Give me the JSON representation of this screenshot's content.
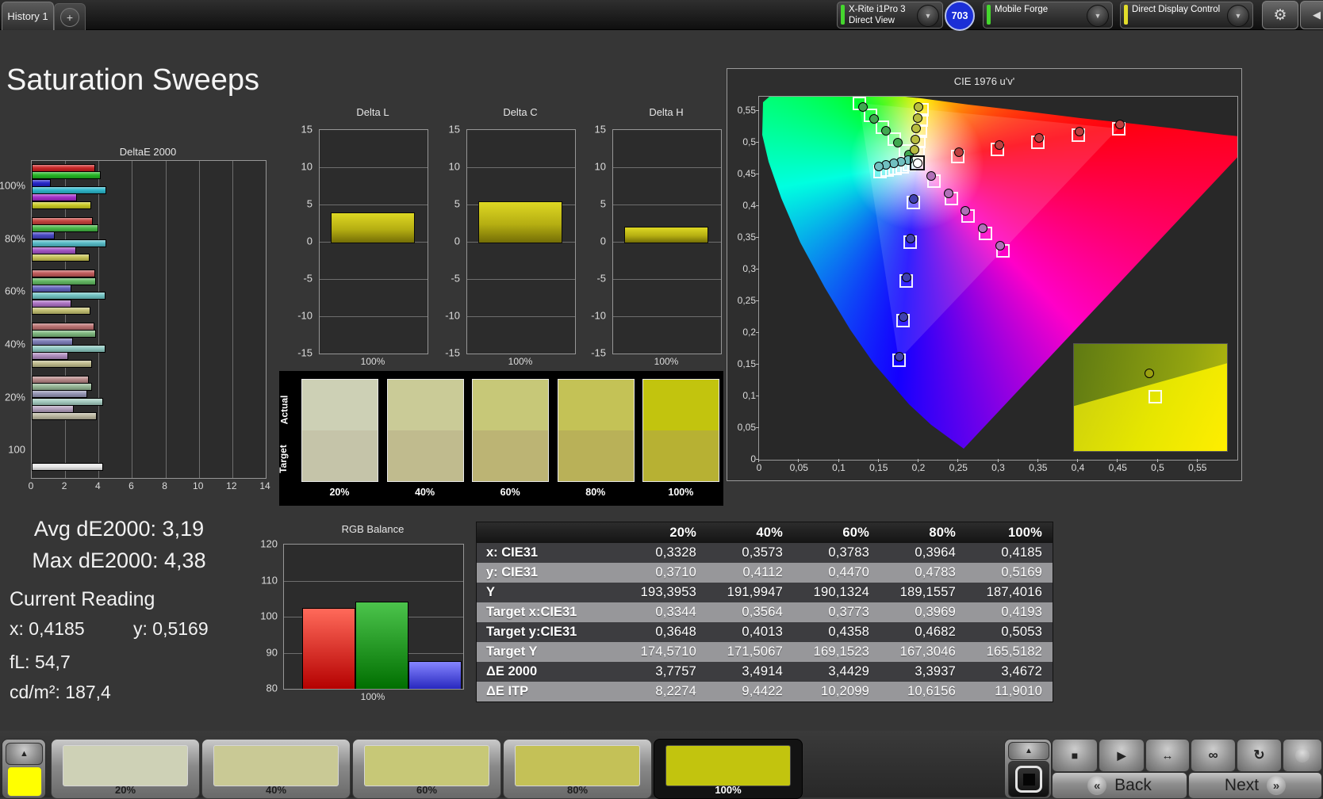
{
  "top_bar": {
    "tab_label": "History 1",
    "add_tab_label": "+",
    "meter_device": {
      "line1": "X-Rite i1Pro 3",
      "line2": "Direct View",
      "status_color": "#45d62e"
    },
    "badge_count": "703",
    "pattern_source": {
      "label": "Mobile Forge",
      "status_color": "#45d62e"
    },
    "display_control": {
      "label": "Direct Display Control",
      "status_color": "#e3de2b"
    }
  },
  "icons": {
    "dropdown": "▼",
    "up_arrow": "▲",
    "collapse_left": "◀",
    "gear": "⚙",
    "add": "+",
    "stop": "■",
    "play": "▶",
    "range": "↔",
    "loop": "∞",
    "refresh": "↻",
    "back_chevron": "«",
    "next_chevron": "»"
  },
  "page_title": "Saturation Sweeps",
  "stats": {
    "avg_label": "Avg dE2000:",
    "avg_value": "3,19",
    "max_label": "Max dE2000:",
    "max_value": "4,38",
    "current_reading_title": "Current Reading",
    "x_label": "x:",
    "x_value": "0,4185",
    "y_label": "y:",
    "y_value": "0,5169",
    "fl_label": "fL:",
    "fl_value": "54,7",
    "cdm2_label": "cd/m²:",
    "cdm2_value": "187,4"
  },
  "swatch_panel": {
    "actual_label": "Actual",
    "target_label": "Target",
    "columns": [
      {
        "label": "20%",
        "actual": "#cdd0b5",
        "target": "#c5c4a9"
      },
      {
        "label": "40%",
        "actual": "#cacb97",
        "target": "#c0bb8e"
      },
      {
        "label": "60%",
        "actual": "#c7c878",
        "target": "#bcb474"
      },
      {
        "label": "80%",
        "actual": "#c4c256",
        "target": "#b9b158"
      },
      {
        "label": "100%",
        "actual": "#c2c40e",
        "target": "#b7b133"
      }
    ]
  },
  "table": {
    "columns": [
      "20%",
      "40%",
      "60%",
      "80%",
      "100%"
    ],
    "rows": [
      {
        "label": "x: CIE31",
        "values": [
          "0,3328",
          "0,3573",
          "0,3783",
          "0,3964",
          "0,4185"
        ]
      },
      {
        "label": "y: CIE31",
        "values": [
          "0,3710",
          "0,4112",
          "0,4470",
          "0,4783",
          "0,5169"
        ]
      },
      {
        "label": "Y",
        "values": [
          "193,3953",
          "191,9947",
          "190,1324",
          "189,1557",
          "187,4016"
        ]
      },
      {
        "label": "Target x:CIE31",
        "values": [
          "0,3344",
          "0,3564",
          "0,3773",
          "0,3969",
          "0,4193"
        ]
      },
      {
        "label": "Target y:CIE31",
        "values": [
          "0,3648",
          "0,4013",
          "0,4358",
          "0,4682",
          "0,5053"
        ]
      },
      {
        "label": "Target Y",
        "values": [
          "174,5710",
          "171,5067",
          "169,1523",
          "167,3046",
          "165,5182"
        ]
      },
      {
        "label": "ΔE 2000",
        "values": [
          "3,7757",
          "3,4914",
          "3,4429",
          "3,3937",
          "3,4672"
        ]
      },
      {
        "label": "ΔE ITP",
        "values": [
          "8,2274",
          "9,4422",
          "10,2099",
          "10,6156",
          "11,9010"
        ]
      }
    ]
  },
  "bottom_bar": {
    "current_patch_color": "#ffff00",
    "patch_buttons": [
      {
        "label": "20%",
        "color": "#ced1b6",
        "selected": false
      },
      {
        "label": "40%",
        "color": "#c9c995",
        "selected": false
      },
      {
        "label": "60%",
        "color": "#c7c877",
        "selected": false
      },
      {
        "label": "80%",
        "color": "#c4c157",
        "selected": false
      },
      {
        "label": "100%",
        "color": "#c2c40e",
        "selected": true
      }
    ],
    "back_label": "Back",
    "next_label": "Next"
  },
  "chart_data": [
    {
      "type": "bar",
      "orientation": "horizontal",
      "title": "DeltaE 2000",
      "xlim": [
        0,
        14
      ],
      "xticks": [
        0,
        2,
        4,
        6,
        8,
        10,
        12,
        14
      ],
      "xtick_labels": [
        "0",
        "2",
        "4",
        "6",
        "8",
        "10",
        "12",
        "14"
      ],
      "groups": [
        {
          "label": "100%",
          "values": [
            3.7,
            4.05,
            1.05,
            4.38,
            2.6,
            3.47
          ],
          "colors": [
            "#c81e1e",
            "#1eb41e",
            "#1e1ec8",
            "#28b4c8",
            "#a028c8",
            "#c8c81e"
          ]
        },
        {
          "label": "80%",
          "values": [
            3.55,
            3.9,
            1.3,
            4.35,
            2.55,
            3.39
          ],
          "colors": [
            "#c23c38",
            "#40b440",
            "#4040c0",
            "#50b8c4",
            "#a050c4",
            "#c4c050"
          ]
        },
        {
          "label": "60%",
          "values": [
            3.7,
            3.75,
            2.3,
            4.32,
            2.3,
            3.44
          ],
          "colors": [
            "#be5454",
            "#5cb45c",
            "#5c5cb8",
            "#6cc0c0",
            "#a86cc0",
            "#c0bc6c"
          ]
        },
        {
          "label": "40%",
          "values": [
            3.65,
            3.75,
            2.35,
            4.3,
            2.1,
            3.49
          ],
          "colors": [
            "#b86c6c",
            "#78b478",
            "#7878b4",
            "#88c4bc",
            "#ac88bc",
            "#bcb888"
          ]
        },
        {
          "label": "20%",
          "values": [
            3.3,
            3.5,
            3.25,
            4.18,
            2.4,
            3.78
          ],
          "colors": [
            "#b48484",
            "#90b290",
            "#9090b0",
            "#a0c8bc",
            "#b09cba",
            "#b8b49c"
          ]
        },
        {
          "label": "100",
          "values": [
            4.18
          ],
          "colors": [
            "#e6e6e6"
          ]
        }
      ]
    },
    {
      "type": "bar",
      "title": "Delta L",
      "xlabel": "100%",
      "ylim": [
        -15,
        15
      ],
      "yticks": [
        15,
        10,
        5,
        0,
        -5,
        -10,
        -15
      ],
      "ytick_labels": [
        "15",
        "10",
        "5",
        "0",
        "-5",
        "-10",
        "-15"
      ],
      "values": [
        3.9
      ]
    },
    {
      "type": "bar",
      "title": "Delta C",
      "xlabel": "100%",
      "ylim": [
        -15,
        15
      ],
      "yticks": [
        15,
        10,
        5,
        0,
        -5,
        -10,
        -15
      ],
      "ytick_labels": [
        "15",
        "10",
        "5",
        "0",
        "-5",
        "-10",
        "-15"
      ],
      "values": [
        5.45
      ]
    },
    {
      "type": "bar",
      "title": "Delta H",
      "xlabel": "100%",
      "ylim": [
        -15,
        15
      ],
      "yticks": [
        15,
        10,
        5,
        0,
        -5,
        -10,
        -15
      ],
      "ytick_labels": [
        "15",
        "10",
        "5",
        "0",
        "-5",
        "-10",
        "-15"
      ],
      "values": [
        2.0
      ]
    },
    {
      "type": "scatter",
      "title": "CIE 1976 u'v'",
      "xlim": [
        0,
        0.6
      ],
      "ylim": [
        0,
        0.5725
      ],
      "xtick_vals": [
        0,
        0.05,
        0.1,
        0.15,
        0.2,
        0.25,
        0.3,
        0.35,
        0.4,
        0.45,
        0.5,
        0.55
      ],
      "xtick_labels": [
        "0",
        "0,05",
        "0,1",
        "0,15",
        "0,2",
        "0,25",
        "0,3",
        "0,35",
        "0,4",
        "0,45",
        "0,5",
        "0,55"
      ],
      "ytick_vals": [
        0,
        0.05,
        0.1,
        0.15,
        0.2,
        0.25,
        0.3,
        0.35,
        0.4,
        0.45,
        0.5,
        0.55
      ],
      "ytick_labels": [
        "0",
        "0,05",
        "0,1",
        "0,15",
        "0,2",
        "0,25",
        "0,3",
        "0,35",
        "0,4",
        "0,45",
        "0,5",
        "0,55"
      ],
      "white_point": {
        "u": 0.1978,
        "v": 0.4683
      },
      "series": [
        {
          "name": "red",
          "color": "#c04040",
          "target": [
            [
              0.2484,
              0.4792
            ],
            [
              0.299,
              0.4901
            ],
            [
              0.3496,
              0.5011
            ],
            [
              0.4001,
              0.512
            ],
            [
              0.4507,
              0.5229
            ]
          ],
          "measured": [
            [
              0.2504,
              0.4852
            ],
            [
              0.301,
              0.4961
            ],
            [
              0.3516,
              0.5071
            ],
            [
              0.4021,
              0.518
            ],
            [
              0.4527,
              0.5289
            ]
          ]
        },
        {
          "name": "green",
          "color": "#40a850",
          "target": [
            [
              0.1832,
              0.4871
            ],
            [
              0.1687,
              0.506
            ],
            [
              0.1541,
              0.5248
            ],
            [
              0.1396,
              0.5437
            ],
            [
              0.125,
              0.5625
            ]
          ],
          "measured": [
            [
              0.1882,
              0.4811
            ],
            [
              0.1737,
              0.5
            ],
            [
              0.1591,
              0.5188
            ],
            [
              0.1446,
              0.5377
            ],
            [
              0.13,
              0.5565
            ]
          ]
        },
        {
          "name": "blue",
          "color": "#4040b0",
          "target": [
            [
              0.1933,
              0.4062
            ],
            [
              0.1888,
              0.3442
            ],
            [
              0.1843,
              0.2821
            ],
            [
              0.1799,
              0.22
            ],
            [
              0.1754,
              0.1579
            ]
          ],
          "measured": [
            [
              0.1943,
              0.4112
            ],
            [
              0.1898,
              0.3492
            ],
            [
              0.1853,
              0.2871
            ],
            [
              0.1809,
              0.225
            ],
            [
              0.1764,
              0.1629
            ]
          ]
        },
        {
          "name": "cyan",
          "color": "#70c0c0",
          "target": [
            [
              0.1885,
              0.4657
            ],
            [
              0.1792,
              0.4631
            ],
            [
              0.1699,
              0.4606
            ],
            [
              0.1606,
              0.458
            ],
            [
              0.1513,
              0.4555
            ]
          ],
          "measured": [
            [
              0.1875,
              0.4727
            ],
            [
              0.1782,
              0.4701
            ],
            [
              0.1689,
              0.4676
            ],
            [
              0.1596,
              0.465
            ],
            [
              0.1503,
              0.4625
            ]
          ]
        },
        {
          "name": "magenta",
          "color": "#b070b8",
          "target": [
            [
              0.2193,
              0.4406
            ],
            [
              0.2407,
              0.413
            ],
            [
              0.2621,
              0.3853
            ],
            [
              0.2836,
              0.3577
            ],
            [
              0.305,
              0.33
            ]
          ],
          "measured": [
            [
              0.2163,
              0.4476
            ],
            [
              0.2377,
              0.42
            ],
            [
              0.2591,
              0.3923
            ],
            [
              0.2806,
              0.3647
            ],
            [
              0.302,
              0.337
            ]
          ]
        },
        {
          "name": "yellow",
          "color": "#b8bc40",
          "target": [
            [
              0.199,
              0.4852
            ],
            [
              0.2003,
              0.5021
            ],
            [
              0.2015,
              0.519
            ],
            [
              0.2028,
              0.5359
            ],
            [
              0.204,
              0.5528
            ]
          ],
          "measured": [
            [
              0.195,
              0.4882
            ],
            [
              0.1963,
              0.5051
            ],
            [
              0.1975,
              0.522
            ],
            [
              0.1988,
              0.5389
            ],
            [
              0.2,
              0.5558
            ]
          ]
        }
      ]
    },
    {
      "type": "bar",
      "title": "RGB Balance",
      "xlabel": "100%",
      "ylim": [
        80,
        120
      ],
      "yticks": [
        120,
        110,
        100,
        90,
        80
      ],
      "ytick_labels": [
        "120",
        "110",
        "100",
        "90",
        "80"
      ],
      "categories": [
        "red",
        "green",
        "blue"
      ],
      "values": [
        102.4,
        104.2,
        87.6
      ],
      "colors": [
        "#e32222",
        "#1f9e1f",
        "#4747e8"
      ]
    }
  ]
}
